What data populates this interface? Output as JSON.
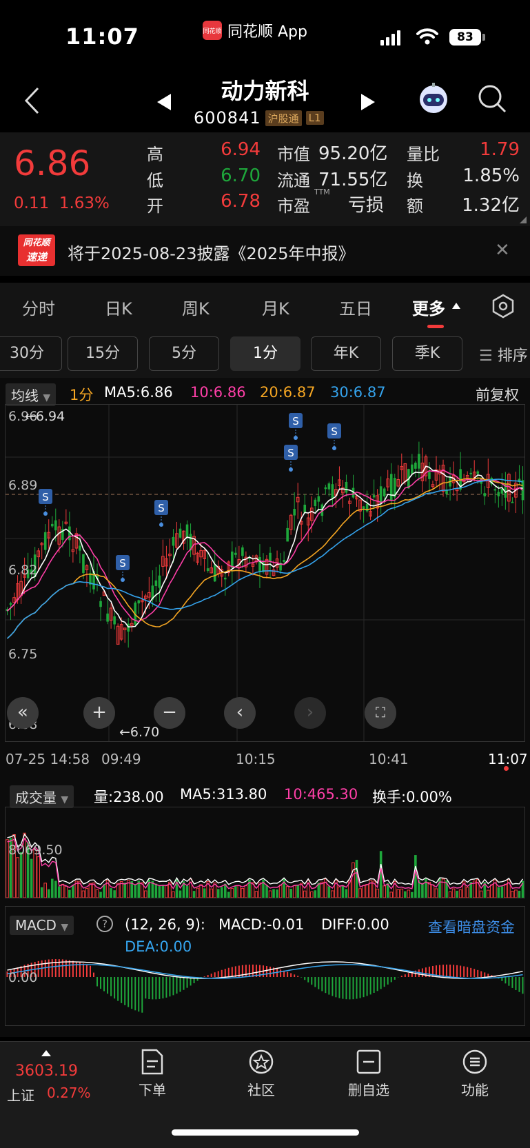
{
  "status": {
    "time": "11:07",
    "app_name": "同花顺 App",
    "battery": "83"
  },
  "header": {
    "name": "动力新科",
    "code": "600841",
    "tag1": "沪股通",
    "tag2": "L1"
  },
  "quote": {
    "price": "6.86",
    "change": "0.11",
    "change_pct": "1.63%",
    "high_label": "高",
    "high": "6.94",
    "low_label": "低",
    "low": "6.70",
    "open_label": "开",
    "open": "6.78",
    "mcap_label": "市值",
    "mcap": "95.20亿",
    "float_label": "流通",
    "float": "71.55亿",
    "pe_label": "市盈",
    "pe_sup": "TTM",
    "pe": "亏损",
    "vr_label": "量比",
    "vr": "1.79",
    "turn_label": "换",
    "turn": "1.85%",
    "amt_label": "额",
    "amt": "1.32亿"
  },
  "notice": {
    "logo_top": "同花顺",
    "logo_bottom": "速递",
    "text": "将于2025-08-23披露《2025年中报》"
  },
  "tabs": [
    "分时",
    "日K",
    "周K",
    "月K",
    "五日",
    "更多"
  ],
  "periods": [
    "30分",
    "15分",
    "5分",
    "1分",
    "年K",
    "季K"
  ],
  "sort_label": "排序",
  "ma_bar": {
    "selector": "均线",
    "period": "1分",
    "ma5": "MA5:6.86",
    "ma10": "10:6.86",
    "ma20": "20:6.87",
    "ma30": "30:6.87",
    "adjust": "前复权"
  },
  "price_axis": {
    "p1": "6.96",
    "p2": "6.89",
    "p3": "6.82",
    "p4": "6.75",
    "p5": "6.68",
    "hi_marker": "←6.94",
    "lo_marker": "←6.70"
  },
  "signal_label": "S",
  "time_axis": [
    "07-25 14:58",
    "09:49",
    "10:15",
    "10:41",
    "11:07"
  ],
  "vol_bar": {
    "selector": "成交量",
    "vol": "量:238.00",
    "ma5": "MA5:313.80",
    "ma10": "10:465.30",
    "turnover": "换手:0.00%",
    "scale": "8069.50"
  },
  "macd_bar": {
    "selector": "MACD",
    "params": "(12, 26, 9):",
    "macd": "MACD:-0.01",
    "diff": "DIFF:0.00",
    "dea": "DEA:0.00",
    "link": "查看暗盘资金",
    "zero": "0.00"
  },
  "bottom": {
    "index_value": "3603.19",
    "index_name": "上证",
    "index_pct": "0.27%",
    "nav": [
      "下单",
      "社区",
      "删自选",
      "功能"
    ]
  },
  "colors": {
    "up": "#f23b3b",
    "down": "#1ea73b",
    "ma5": "#ffffff",
    "ma10": "#ff3fa8",
    "ma20": "#f5a623",
    "ma30": "#35a4ee"
  }
}
